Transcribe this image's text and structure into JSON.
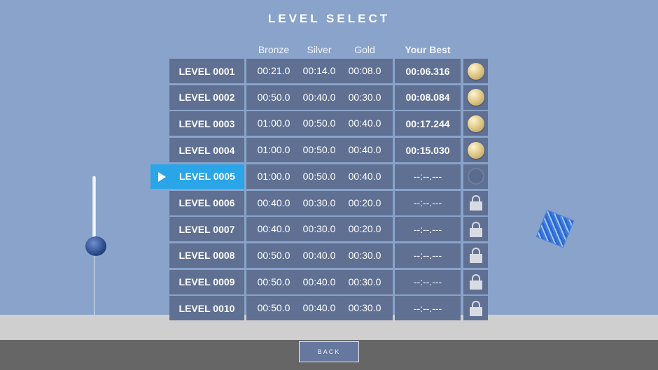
{
  "title": "LEVEL SELECT",
  "headers": {
    "bronze": "Bronze",
    "silver": "Silver",
    "gold": "Gold",
    "best": "Your Best"
  },
  "levels": [
    {
      "name": "LEVEL 0001",
      "bronze": "00:21.0",
      "silver": "00:14.0",
      "gold": "00:08.0",
      "best": "00:06.316",
      "status": "gold-medal"
    },
    {
      "name": "LEVEL 0002",
      "bronze": "00:50.0",
      "silver": "00:40.0",
      "gold": "00:30.0",
      "best": "00:08.084",
      "status": "gold-medal"
    },
    {
      "name": "LEVEL 0003",
      "bronze": "01:00.0",
      "silver": "00:50.0",
      "gold": "00:40.0",
      "best": "00:17.244",
      "status": "gold-medal"
    },
    {
      "name": "LEVEL 0004",
      "bronze": "01:00.0",
      "silver": "00:50.0",
      "gold": "00:40.0",
      "best": "00:15.030",
      "status": "gold-medal"
    },
    {
      "name": "LEVEL 0005",
      "bronze": "01:00.0",
      "silver": "00:50.0",
      "gold": "00:40.0",
      "best": "--:--.---",
      "status": "empty-medal",
      "selected": true
    },
    {
      "name": "LEVEL 0006",
      "bronze": "00:40.0",
      "silver": "00:30.0",
      "gold": "00:20.0",
      "best": "--:--.---",
      "status": "lock"
    },
    {
      "name": "LEVEL 0007",
      "bronze": "00:40.0",
      "silver": "00:30.0",
      "gold": "00:20.0",
      "best": "--:--.---",
      "status": "lock"
    },
    {
      "name": "LEVEL 0008",
      "bronze": "00:50.0",
      "silver": "00:40.0",
      "gold": "00:30.0",
      "best": "--:--.---",
      "status": "lock"
    },
    {
      "name": "LEVEL 0009",
      "bronze": "00:50.0",
      "silver": "00:40.0",
      "gold": "00:30.0",
      "best": "--:--.---",
      "status": "lock"
    },
    {
      "name": "LEVEL 0010",
      "bronze": "00:50.0",
      "silver": "00:40.0",
      "gold": "00:30.0",
      "best": "--:--.---",
      "status": "lock"
    }
  ],
  "back_label": "BACK",
  "icons": {
    "selected_marker": "play-icon",
    "completed": "gold-medal-icon",
    "unplayed": "empty-medal-icon",
    "locked": "lock-icon"
  },
  "colors": {
    "background": "#8aa3ca",
    "row": "#5f7093",
    "selected": "#29a5e8",
    "floor": "#cfcfcf",
    "bar": "#666666"
  }
}
